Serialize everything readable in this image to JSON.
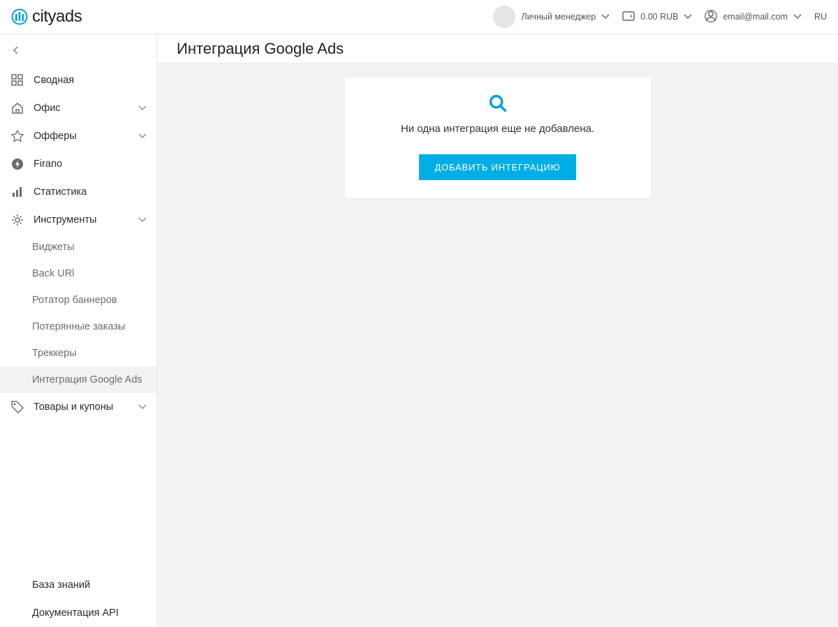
{
  "header": {
    "brand": "cityads",
    "manager_label": "Личный менеджер",
    "balance": "0.00 RUB",
    "email": "email@mail.com",
    "lang": "RU"
  },
  "sidebar": {
    "items": [
      {
        "label": "Сводная",
        "icon": "dashboard"
      },
      {
        "label": "Офис",
        "icon": "home",
        "expandable": true
      },
      {
        "label": "Офферы",
        "icon": "star",
        "expandable": true
      },
      {
        "label": "Firano",
        "icon": "bolt-circle"
      },
      {
        "label": "Статистика",
        "icon": "bars"
      },
      {
        "label": "Инструменты",
        "icon": "gear",
        "expandable": true,
        "expanded": true,
        "children": [
          {
            "label": "Виджеты"
          },
          {
            "label": "Back URl"
          },
          {
            "label": "Ротатор баннеров"
          },
          {
            "label": "Потерянные заказы"
          },
          {
            "label": "Треккеры"
          },
          {
            "label": "Интеграция Google Ads",
            "active": true
          }
        ]
      },
      {
        "label": "Товары и купоны",
        "icon": "tag",
        "expandable": true
      }
    ],
    "bottom": [
      {
        "label": "База знаний"
      },
      {
        "label": "Документация API"
      }
    ]
  },
  "page": {
    "title": "Интеграция Google Ads",
    "empty_message": "Ни одна интеграция еще не добавлена.",
    "add_button": "ДОБАВИТЬ ИНТЕГРАЦИЮ"
  }
}
